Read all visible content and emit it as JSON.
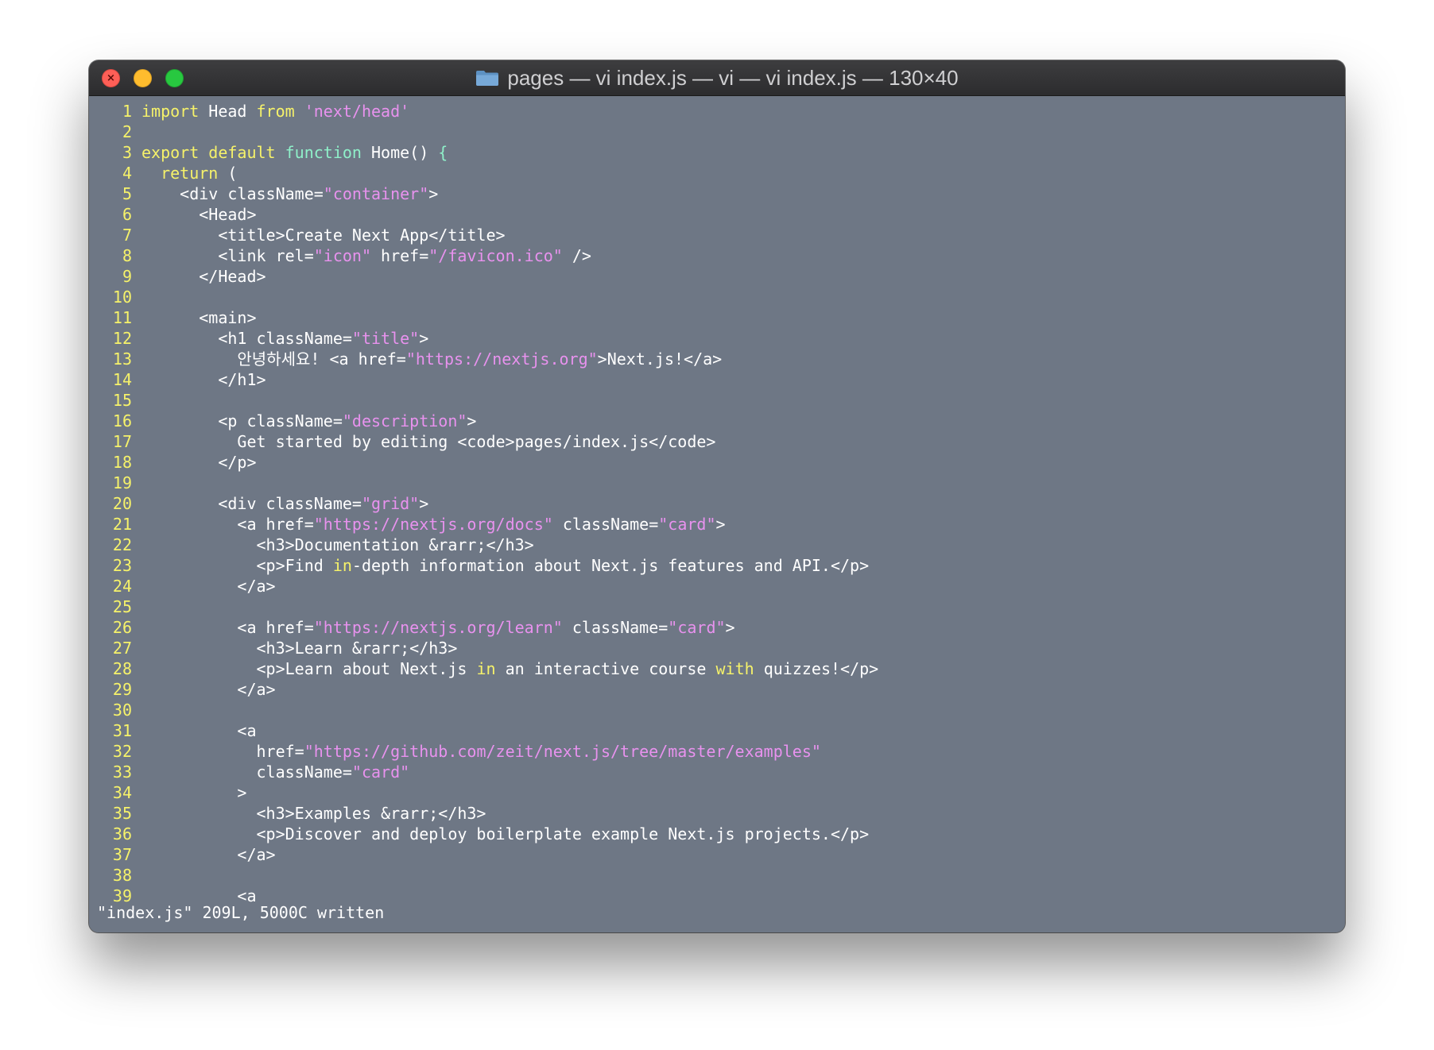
{
  "window": {
    "title": "pages — vi index.js — vi — vi index.js — 130×40",
    "folder_icon": "folder-icon",
    "traffic_lights": {
      "close": "#fe5f57",
      "minimize": "#febc2e",
      "zoom": "#28c840",
      "close_glyph": "×"
    }
  },
  "colors": {
    "background": "#6e7785",
    "text": "#ffffff",
    "keyword": "#f6f26a",
    "function": "#8ff0c9",
    "string": "#e892ee",
    "line_number": "#f6f26a"
  },
  "editor": {
    "lines": [
      {
        "n": "1",
        "segs": [
          {
            "t": "import",
            "c": "kw"
          },
          {
            "t": " Head "
          },
          {
            "t": "from",
            "c": "kw"
          },
          {
            "t": " "
          },
          {
            "t": "'next/head'",
            "c": "str"
          }
        ]
      },
      {
        "n": "2",
        "segs": []
      },
      {
        "n": "3",
        "segs": [
          {
            "t": "export",
            "c": "kw"
          },
          {
            "t": " "
          },
          {
            "t": "default",
            "c": "kw"
          },
          {
            "t": " "
          },
          {
            "t": "function",
            "c": "fn"
          },
          {
            "t": " Home() "
          },
          {
            "t": "{",
            "c": "fn"
          }
        ]
      },
      {
        "n": "4",
        "segs": [
          {
            "t": "  "
          },
          {
            "t": "return",
            "c": "kw"
          },
          {
            "t": " ("
          }
        ]
      },
      {
        "n": "5",
        "segs": [
          {
            "t": "    <div className="
          },
          {
            "t": "\"container\"",
            "c": "str"
          },
          {
            "t": ">"
          }
        ]
      },
      {
        "n": "6",
        "segs": [
          {
            "t": "      <Head>"
          }
        ]
      },
      {
        "n": "7",
        "segs": [
          {
            "t": "        <title>Create Next App</title>"
          }
        ]
      },
      {
        "n": "8",
        "segs": [
          {
            "t": "        <link rel="
          },
          {
            "t": "\"icon\"",
            "c": "str"
          },
          {
            "t": " href="
          },
          {
            "t": "\"/favicon.ico\"",
            "c": "str"
          },
          {
            "t": " />"
          }
        ]
      },
      {
        "n": "9",
        "segs": [
          {
            "t": "      </Head>"
          }
        ]
      },
      {
        "n": "10",
        "segs": []
      },
      {
        "n": "11",
        "segs": [
          {
            "t": "      <main>"
          }
        ]
      },
      {
        "n": "12",
        "segs": [
          {
            "t": "        <h1 className="
          },
          {
            "t": "\"title\"",
            "c": "str"
          },
          {
            "t": ">"
          }
        ]
      },
      {
        "n": "13",
        "segs": [
          {
            "t": "          안녕하세요! <a href="
          },
          {
            "t": "\"https://nextjs.org\"",
            "c": "str"
          },
          {
            "t": ">Next.js!</a>"
          }
        ]
      },
      {
        "n": "14",
        "segs": [
          {
            "t": "        </h1>"
          }
        ]
      },
      {
        "n": "15",
        "segs": []
      },
      {
        "n": "16",
        "segs": [
          {
            "t": "        <p className="
          },
          {
            "t": "\"description\"",
            "c": "str"
          },
          {
            "t": ">"
          }
        ]
      },
      {
        "n": "17",
        "segs": [
          {
            "t": "          Get started by editing <code>pages/index.js</code>"
          }
        ]
      },
      {
        "n": "18",
        "segs": [
          {
            "t": "        </p>"
          }
        ]
      },
      {
        "n": "19",
        "segs": []
      },
      {
        "n": "20",
        "segs": [
          {
            "t": "        <div className="
          },
          {
            "t": "\"grid\"",
            "c": "str"
          },
          {
            "t": ">"
          }
        ]
      },
      {
        "n": "21",
        "segs": [
          {
            "t": "          <a href="
          },
          {
            "t": "\"https://nextjs.org/docs\"",
            "c": "str"
          },
          {
            "t": " className="
          },
          {
            "t": "\"card\"",
            "c": "str"
          },
          {
            "t": ">"
          }
        ]
      },
      {
        "n": "22",
        "segs": [
          {
            "t": "            <h3>Documentation &rarr;</h3>"
          }
        ]
      },
      {
        "n": "23",
        "segs": [
          {
            "t": "            <p>Find "
          },
          {
            "t": "in",
            "c": "kw"
          },
          {
            "t": "-depth information about Next.js features and API.</p>"
          }
        ]
      },
      {
        "n": "24",
        "segs": [
          {
            "t": "          </a>"
          }
        ]
      },
      {
        "n": "25",
        "segs": []
      },
      {
        "n": "26",
        "segs": [
          {
            "t": "          <a href="
          },
          {
            "t": "\"https://nextjs.org/learn\"",
            "c": "str"
          },
          {
            "t": " className="
          },
          {
            "t": "\"card\"",
            "c": "str"
          },
          {
            "t": ">"
          }
        ]
      },
      {
        "n": "27",
        "segs": [
          {
            "t": "            <h3>Learn &rarr;</h3>"
          }
        ]
      },
      {
        "n": "28",
        "segs": [
          {
            "t": "            <p>Learn about Next.js "
          },
          {
            "t": "in",
            "c": "kw"
          },
          {
            "t": " an interactive course "
          },
          {
            "t": "with",
            "c": "kw"
          },
          {
            "t": " quizzes!</p>"
          }
        ]
      },
      {
        "n": "29",
        "segs": [
          {
            "t": "          </a>"
          }
        ]
      },
      {
        "n": "30",
        "segs": []
      },
      {
        "n": "31",
        "segs": [
          {
            "t": "          <a"
          }
        ]
      },
      {
        "n": "32",
        "segs": [
          {
            "t": "            href="
          },
          {
            "t": "\"https://github.com/zeit/next.js/tree/master/examples\"",
            "c": "str"
          }
        ]
      },
      {
        "n": "33",
        "segs": [
          {
            "t": "            className="
          },
          {
            "t": "\"card\"",
            "c": "str"
          }
        ]
      },
      {
        "n": "34",
        "segs": [
          {
            "t": "          >"
          }
        ]
      },
      {
        "n": "35",
        "segs": [
          {
            "t": "            <h3>Examples &rarr;</h3>"
          }
        ]
      },
      {
        "n": "36",
        "segs": [
          {
            "t": "            <p>Discover and deploy boilerplate example Next.js projects.</p>"
          }
        ]
      },
      {
        "n": "37",
        "segs": [
          {
            "t": "          </a>"
          }
        ]
      },
      {
        "n": "38",
        "segs": []
      },
      {
        "n": "39",
        "segs": [
          {
            "t": "          <a"
          }
        ]
      }
    ]
  },
  "status_bar": {
    "message": "\"index.js\" 209L, 5000C written"
  }
}
